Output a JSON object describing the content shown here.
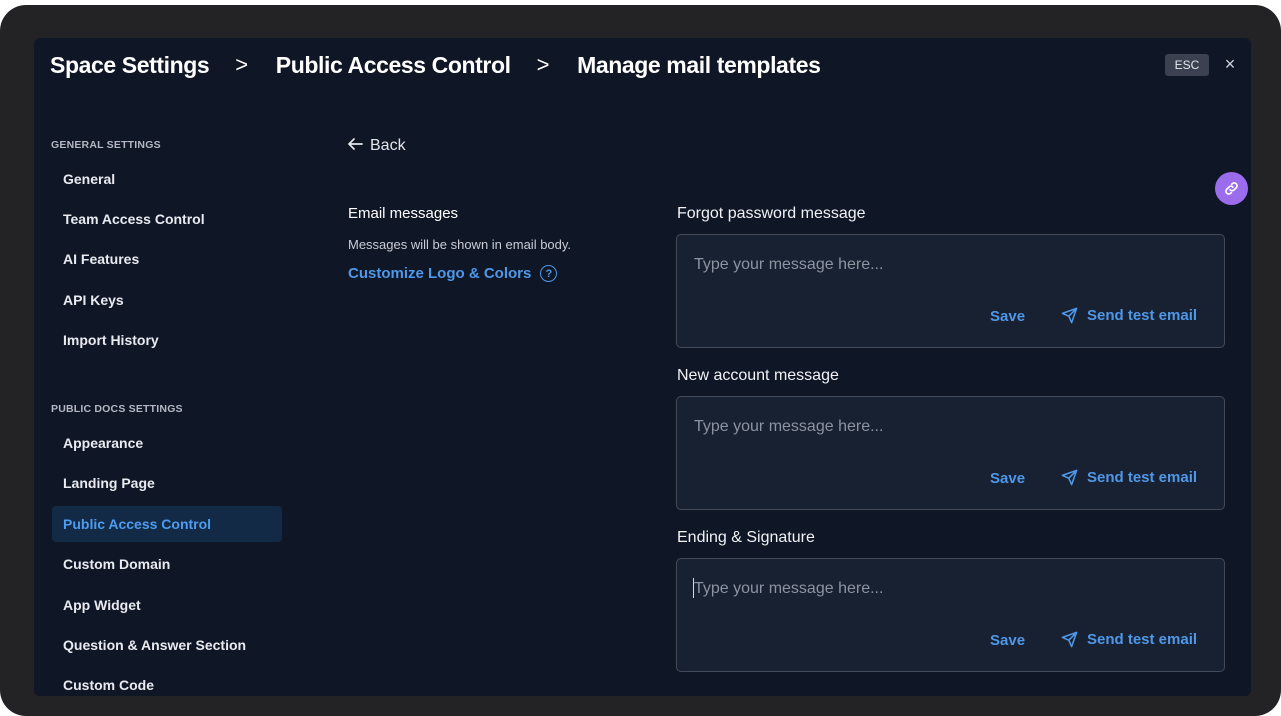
{
  "header": {
    "breadcrumbs": [
      "Space Settings",
      "Public Access Control",
      "Manage mail templates"
    ],
    "separator": ">",
    "esc_label": "ESC",
    "close_symbol": "×"
  },
  "sidebar": {
    "general_heading": "GENERAL SETTINGS",
    "general_items": [
      "General",
      "Team Access Control",
      "AI Features",
      "API Keys",
      "Import History"
    ],
    "public_heading": "PUBLIC DOCS SETTINGS",
    "public_items": [
      "Appearance",
      "Landing Page",
      "Public Access Control",
      "Custom Domain",
      "App Widget",
      "Question & Answer Section",
      "Custom Code"
    ],
    "active_item": "Public Access Control"
  },
  "content": {
    "back_label": "Back",
    "email_messages_title": "Email messages",
    "email_messages_desc": "Messages will be shown in email body.",
    "customize_link": "Customize Logo & Colors",
    "templates": [
      {
        "label": "Forgot password message",
        "placeholder": "Type your message here...",
        "value": "",
        "save_label": "Save",
        "send_label": "Send test email"
      },
      {
        "label": "New account message",
        "placeholder": "Type your message here...",
        "value": "",
        "save_label": "Save",
        "send_label": "Send test email"
      },
      {
        "label": "Ending & Signature",
        "placeholder": "Type your message here...",
        "value": "",
        "save_label": "Save",
        "send_label": "Send test email"
      }
    ]
  },
  "icons": {
    "back": "arrow-left-icon",
    "help": "question-circle-icon",
    "send": "paper-plane-icon",
    "close": "close-icon",
    "fab": "link-icon"
  },
  "colors": {
    "modal_bg": "#0f1625",
    "accent": "#4f97e8",
    "active_nav_bg": "#122a46",
    "fab": "#9b6cec"
  }
}
